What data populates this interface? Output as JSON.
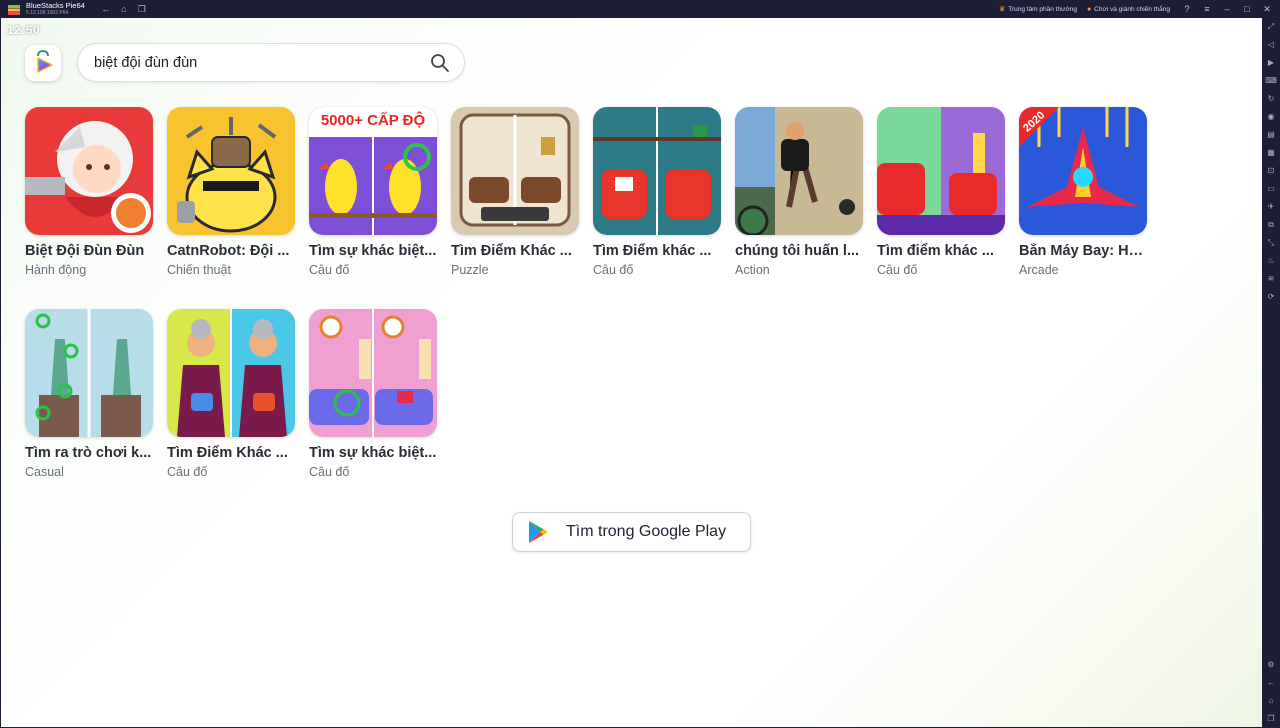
{
  "titlebar": {
    "app_title": "BlueStacks Pie64",
    "version": "5.12.108.1002 P64",
    "rewards_label": "Trung tâm phần thưởng",
    "play_win_label": "Chơi và giành chiến thắng"
  },
  "status": {
    "clock": "12:50"
  },
  "search": {
    "query": "biệt đội đùn đùn",
    "placeholder": ""
  },
  "results": [
    {
      "name": "Biệt Đội Đùn Đùn",
      "category": "Hành động",
      "icon": "game-thumbnail-hero"
    },
    {
      "name": "CatnRobot: Đội ...",
      "category": "Chiến thuật",
      "icon": "game-thumbnail-cat-robot"
    },
    {
      "name": "Tìm sự khác biệt...",
      "category": "Câu đố",
      "icon": "game-thumbnail-parrots",
      "badge": "5000+ CẤP ĐỘ"
    },
    {
      "name": "Tìm Điểm Khác ...",
      "category": "Puzzle",
      "icon": "game-thumbnail-sofa-room"
    },
    {
      "name": "Tìm Điểm khác ...",
      "category": "Câu đố",
      "icon": "game-thumbnail-red-chairs"
    },
    {
      "name": "chúng tôi huấn l...",
      "category": "Action",
      "icon": "game-thumbnail-climber"
    },
    {
      "name": "Tìm điểm khác ...",
      "category": "Câu đố",
      "icon": "game-thumbnail-red-sofa"
    },
    {
      "name": "Bắn Máy Bay: Hạ...",
      "category": "Arcade",
      "icon": "game-thumbnail-spaceship",
      "badge": "2020"
    },
    {
      "name": "Tìm ra trò chơi k...",
      "category": "Casual",
      "icon": "game-thumbnail-statue-liberty"
    },
    {
      "name": "Tìm Điểm Khác ...",
      "category": "Câu đố",
      "icon": "game-thumbnail-grandma"
    },
    {
      "name": "Tìm sự khác biệt...",
      "category": "Câu đố",
      "icon": "game-thumbnail-pink-room"
    }
  ],
  "google_play_button": {
    "label": "Tìm trong Google Play"
  },
  "colors": {
    "accent": "#1c1e35",
    "text_primary": "#2a2d36",
    "text_secondary": "#6a6f7b"
  }
}
